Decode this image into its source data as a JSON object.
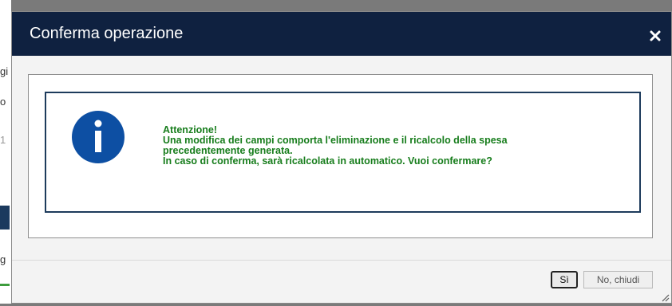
{
  "background": {
    "glyphs": [
      "gi",
      "o",
      "1",
      "g"
    ]
  },
  "dialog": {
    "title": "Conferma operazione",
    "close_icon": "close-icon",
    "info_icon": "info-icon",
    "message_lines": [
      "Attenzione!",
      "Una modifica dei campi comporta l'eliminazione e il ricalcolo della spesa",
      "precedentemente generata.",
      "In caso di conferma, sarà ricalcolata in automatico. Vuoi confermare?"
    ],
    "buttons": {
      "yes_label": "Sì",
      "no_label": "No, chiudi"
    }
  },
  "colors": {
    "titlebar": "#0f2140",
    "message_text": "#177d1c",
    "info_icon": "#0d4fa3",
    "message_border": "#1d3b5c"
  }
}
